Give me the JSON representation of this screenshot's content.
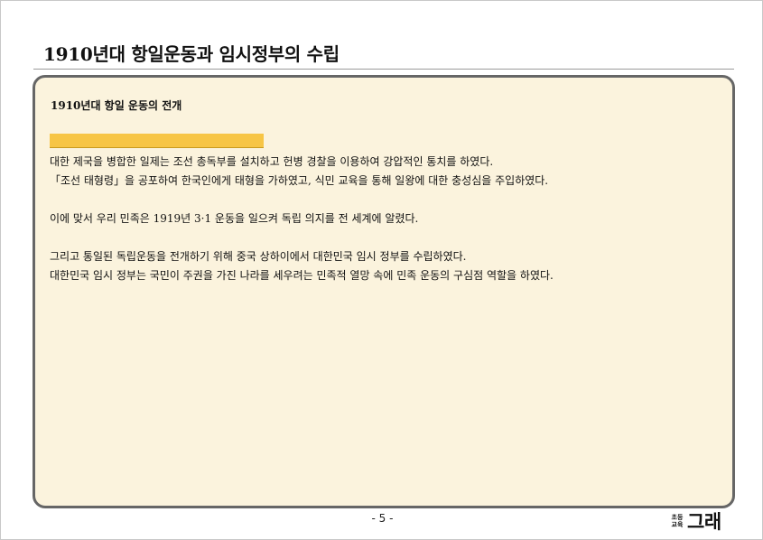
{
  "page": {
    "title": "1910년대 항일운동과 임시정부의 수립",
    "page_number": "- 5 -"
  },
  "section": {
    "heading": "1910년대 항일 운동의 전개",
    "highlight_color": "#f7c545",
    "box_background": "#fbf3dd",
    "box_border": "#666666"
  },
  "paragraphs": [
    {
      "lines": [
        " 대한 제국을 병합한 일제는 조선 총독부를 설치하고 헌병 경찰을 이용하여 강압적인 통치를 하였다.",
        "「조선 태형령」을 공포하여 한국인에게 태형을 가하였고, 식민 교육을 통해 일왕에 대한 충성심을 주입하였다."
      ]
    },
    {
      "lines": [
        " 이에 맞서 우리 민족은 1919년 3·1 운동을 일으켜 독립 의지를 전 세계에 알렸다."
      ]
    },
    {
      "lines": [
        "그리고 통일된 독립운동을 전개하기 위해 중국 상하이에서 대한민국 임시 정부를 수립하였다.",
        "대한민국 임시 정부는 국민이 주권을 가진 나라를 세우려는 민족적 열망 속에 민족 운동의 구심점 역할을 하였다."
      ]
    }
  ],
  "logo": {
    "small_text": "초등 교육",
    "big_text": "그래"
  }
}
